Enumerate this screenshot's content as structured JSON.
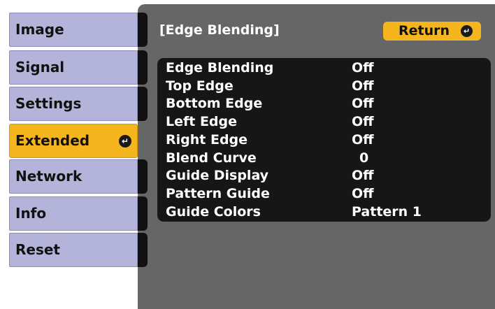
{
  "menu": {
    "items": [
      {
        "label": "Image",
        "selected": false
      },
      {
        "label": "Signal",
        "selected": false
      },
      {
        "label": "Settings",
        "selected": false
      },
      {
        "label": "Extended",
        "selected": true
      },
      {
        "label": "Network",
        "selected": false
      },
      {
        "label": "Info",
        "selected": false
      },
      {
        "label": "Reset",
        "selected": false
      }
    ],
    "enter_icon": "enter-icon"
  },
  "panel": {
    "title": "[Edge Blending]",
    "return_label": "Return"
  },
  "settings": [
    {
      "label": "Edge Blending",
      "value": "Off"
    },
    {
      "label": "Top Edge",
      "value": "Off"
    },
    {
      "label": "Bottom Edge",
      "value": "Off"
    },
    {
      "label": "Left Edge",
      "value": "Off"
    },
    {
      "label": "Right Edge",
      "value": "Off"
    },
    {
      "label": "Blend Curve",
      "value": "0"
    },
    {
      "label": "Guide Display",
      "value": "Off"
    },
    {
      "label": "Pattern Guide",
      "value": "Off"
    },
    {
      "label": "Guide Colors",
      "value": "Pattern 1"
    }
  ],
  "colors": {
    "tab": "#b4b3d9",
    "selected_tab": "#f5b51e",
    "panel": "#666666",
    "settings_box": "#161616",
    "text_light": "#ffffff"
  }
}
